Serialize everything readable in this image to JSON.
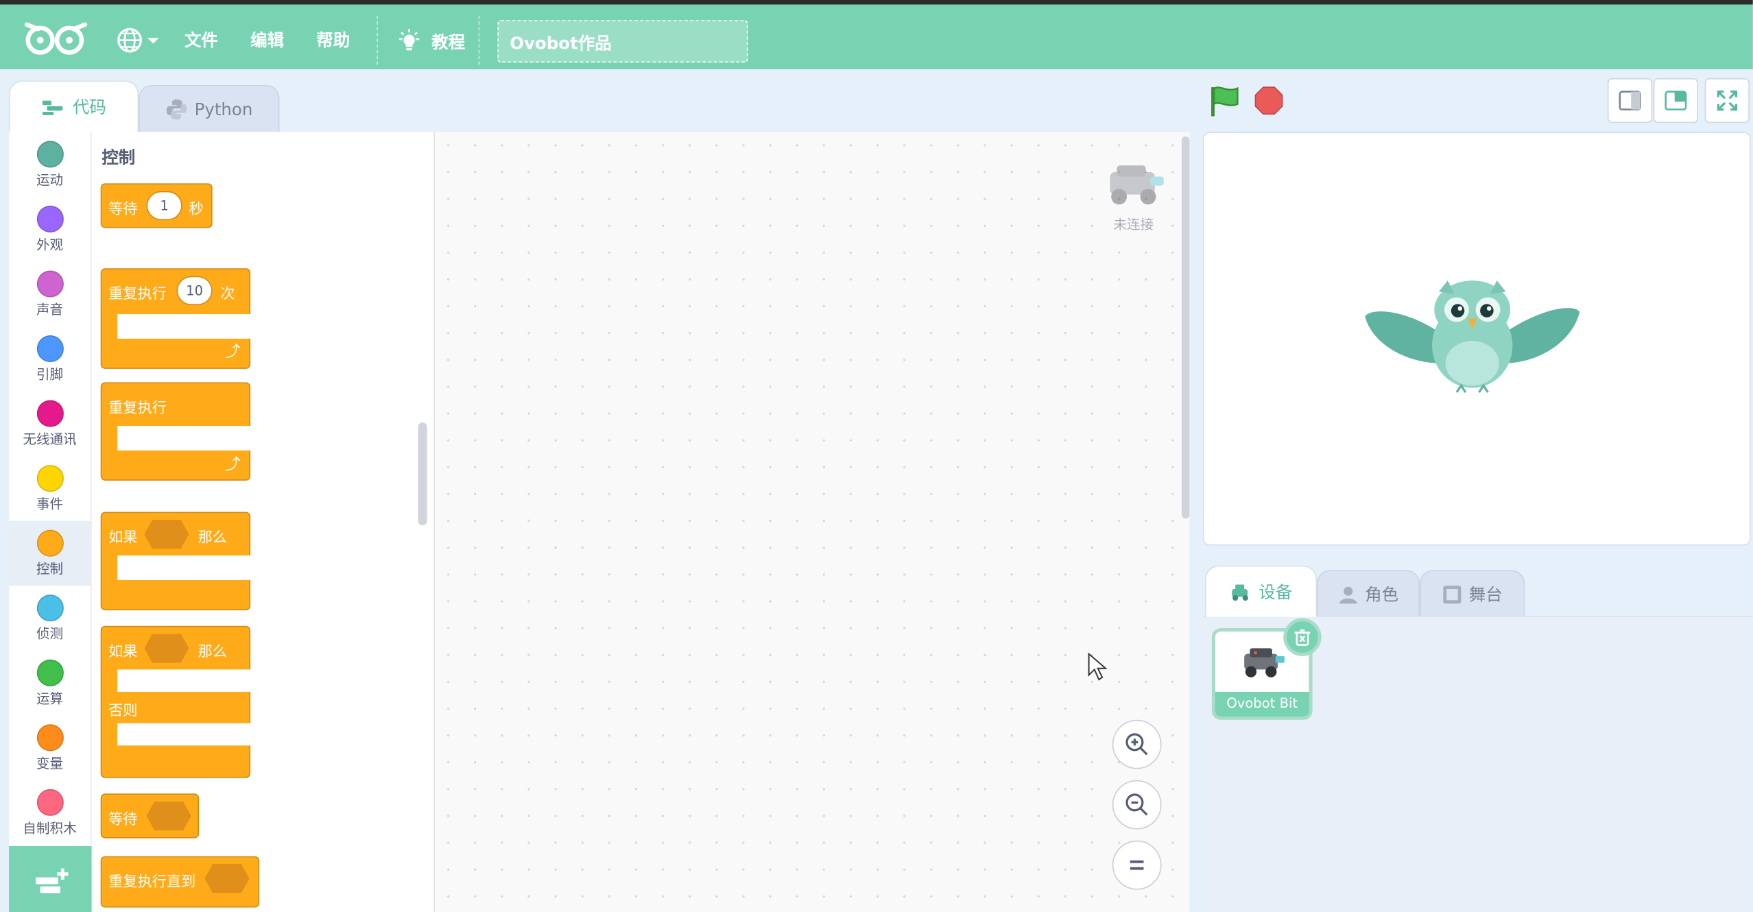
{
  "menubar": {
    "file": "文件",
    "edit": "编辑",
    "help": "帮助",
    "tutorial": "教程",
    "project_title": "Ovobot作品"
  },
  "editor_tabs": {
    "code": "代码",
    "python": "Python"
  },
  "categories": [
    {
      "label": "运动",
      "color": "#5cb1a0"
    },
    {
      "label": "外观",
      "color": "#9966ff"
    },
    {
      "label": "声音",
      "color": "#cf63cf"
    },
    {
      "label": "引脚",
      "color": "#4c97ff"
    },
    {
      "label": "无线通讯",
      "color": "#e6198c"
    },
    {
      "label": "事件",
      "color": "#ffd500"
    },
    {
      "label": "控制",
      "color": "#ffab19"
    },
    {
      "label": "侦测",
      "color": "#4cbfe6"
    },
    {
      "label": "运算",
      "color": "#40bf4a"
    },
    {
      "label": "变量",
      "color": "#ff8c1a"
    },
    {
      "label": "自制积木",
      "color": "#ff6680"
    }
  ],
  "palette": {
    "heading": "控制",
    "wait": {
      "label": "等待",
      "value": "1",
      "unit": "秒"
    },
    "repeat": {
      "label": "重复执行",
      "value": "10",
      "unit": "次"
    },
    "forever": {
      "label": "重复执行"
    },
    "if_then": {
      "if": "如果",
      "then": "那么"
    },
    "if_else": {
      "if": "如果",
      "then": "那么",
      "else": "否则"
    },
    "wait_until": {
      "label": "等待"
    },
    "repeat_until": {
      "label": "重复执行直到"
    }
  },
  "workspace": {
    "connection_status": "未连接"
  },
  "sprite_tabs": {
    "device": "设备",
    "role": "角色",
    "stage": "舞台"
  },
  "device": {
    "name": "Ovobot Bit"
  },
  "colors": {
    "accent": "#78d3b2",
    "control": "#ffab19",
    "background": "#e6f0fb"
  }
}
